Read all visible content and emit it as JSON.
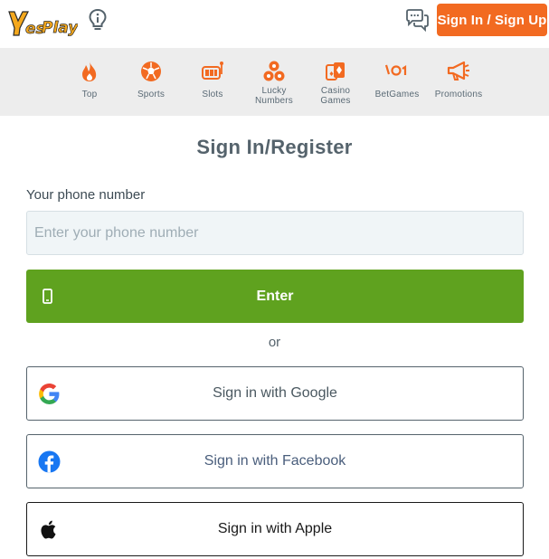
{
  "header": {
    "logo_text": "YesPlay",
    "info_icon": "lightbulb-info-icon",
    "chat_icon": "chat-bubbles-icon",
    "signin_label": "Sign In / Sign Up",
    "accent_color": "#f26a21"
  },
  "nav": {
    "items": [
      {
        "label": "Top",
        "icon": "fire-icon"
      },
      {
        "label": "Sports",
        "icon": "soccer-ball-icon"
      },
      {
        "label": "Slots",
        "icon": "slot-machine-icon"
      },
      {
        "label": "Lucky Numbers",
        "icon": "lottery-balls-icon"
      },
      {
        "label": "Casino Games",
        "icon": "playing-cards-icon"
      },
      {
        "label": "BetGames",
        "icon": "betgames-icon"
      },
      {
        "label": "Promotions",
        "icon": "megaphone-icon"
      }
    ],
    "icon_color": "#f26a21"
  },
  "main": {
    "title": "Sign In/Register",
    "phone_label": "Your phone number",
    "phone_placeholder": "Enter your phone number",
    "phone_value": "",
    "enter_label": "Enter",
    "enter_color": "#5fa21f",
    "or_text": "or",
    "google_label": "Sign in with Google",
    "facebook_label": "Sign in with Facebook",
    "apple_label": "Sign in with Apple"
  }
}
